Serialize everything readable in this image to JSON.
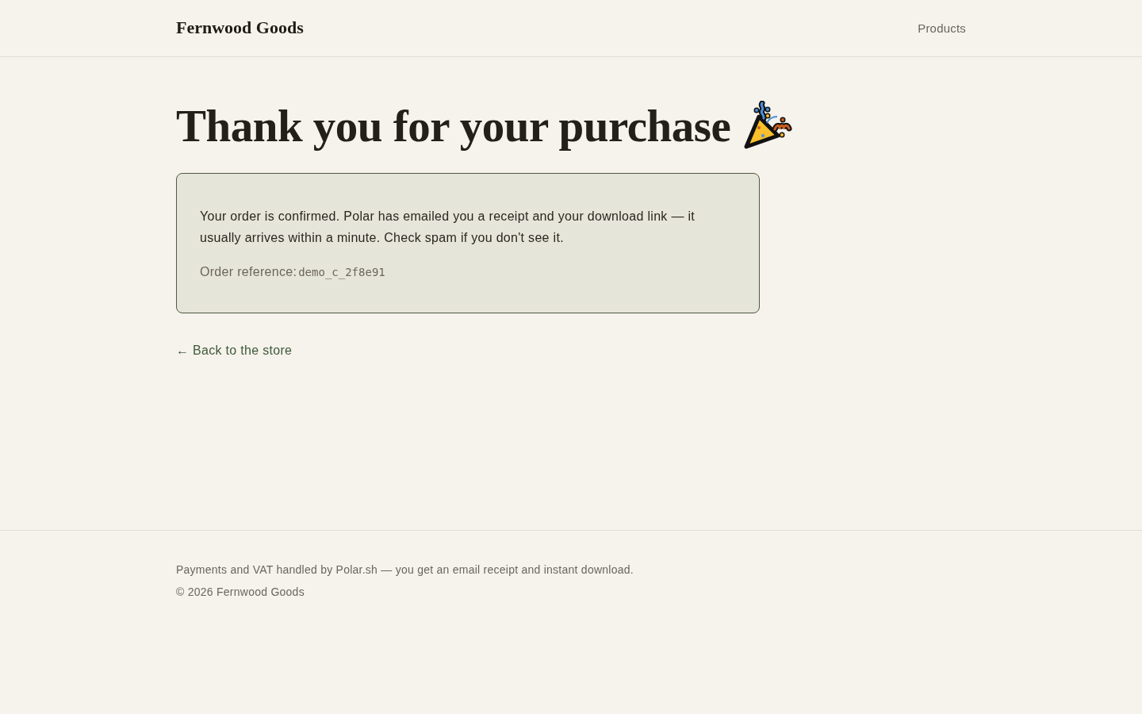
{
  "header": {
    "brand": "Fernwood Goods",
    "nav": [
      {
        "label": "Products"
      }
    ]
  },
  "main": {
    "title": "Thank you for your purchase",
    "confirmation": {
      "message": "Your order is confirmed. Polar has emailed you a receipt and your download link — it usually arrives within a minute. Check spam if you don't see it.",
      "reference_label": "Order reference:",
      "reference_code": "demo_c_2f8e91"
    },
    "back_link": "← Back to the store"
  },
  "footer": {
    "lines": [
      "Payments and VAT handled by Polar.sh — you get an email receipt and instant download.",
      "© 2026 Fernwood Goods"
    ]
  }
}
